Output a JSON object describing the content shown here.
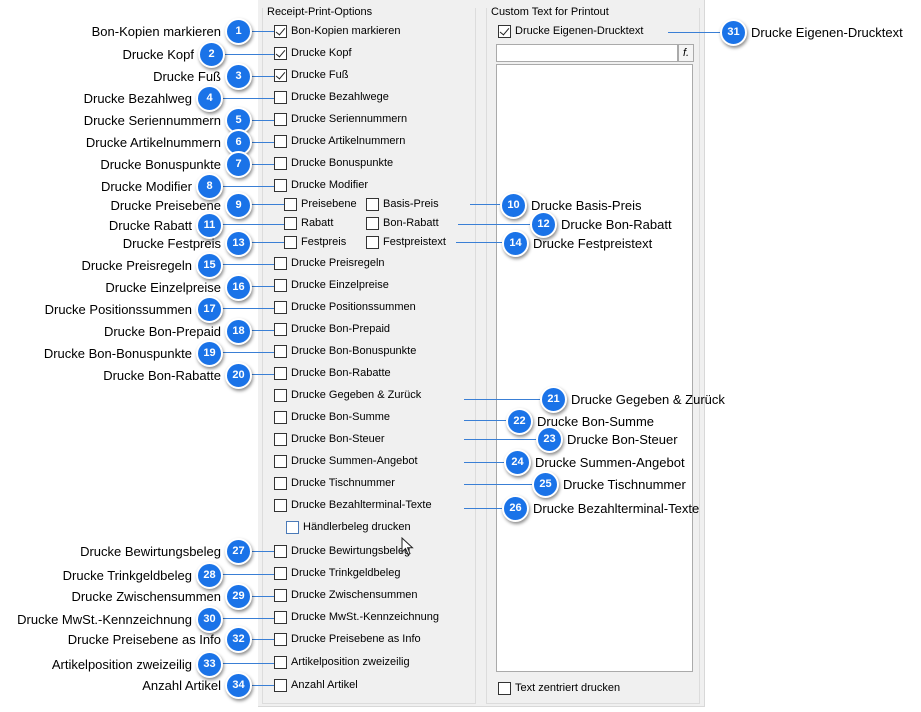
{
  "groups": {
    "receipt_title": "Receipt-Print-Options",
    "custom_title": "Custom Text for Printout"
  },
  "custom": {
    "drucke_eigenen_drucktext": "Drucke Eigenen-Drucktext",
    "fx_label": "f",
    "text_zentriert": "Text zentriert drucken"
  },
  "options": [
    {
      "label": "Bon-Kopien markieren",
      "checked": true
    },
    {
      "label": "Drucke Kopf",
      "checked": true
    },
    {
      "label": "Drucke Fuß",
      "checked": true
    },
    {
      "label": "Drucke Bezahlwege",
      "checked": false
    },
    {
      "label": "Drucke Seriennummern",
      "checked": false
    },
    {
      "label": "Drucke Artikelnummern",
      "checked": false
    },
    {
      "label": "Drucke Bonuspunkte",
      "checked": false
    },
    {
      "label": "Drucke Modifier",
      "checked": false
    },
    {
      "label": "Preisebene",
      "checked": false
    },
    {
      "label": "Basis-Preis",
      "checked": false
    },
    {
      "label": "Rabatt",
      "checked": false
    },
    {
      "label": "Bon-Rabatt",
      "checked": false
    },
    {
      "label": "Festpreis",
      "checked": false
    },
    {
      "label": "Festpreistext",
      "checked": false
    },
    {
      "label": "Drucke Preisregeln",
      "checked": false
    },
    {
      "label": "Drucke Einzelpreise",
      "checked": false
    },
    {
      "label": "Drucke Positionssummen",
      "checked": false
    },
    {
      "label": "Drucke Bon-Prepaid",
      "checked": false
    },
    {
      "label": "Drucke Bon-Bonuspunkte",
      "checked": false
    },
    {
      "label": "Drucke Bon-Rabatte",
      "checked": false
    },
    {
      "label": "Drucke Gegeben & Zurück",
      "checked": false
    },
    {
      "label": "Drucke Bon-Summe",
      "checked": false
    },
    {
      "label": "Drucke Bon-Steuer",
      "checked": false
    },
    {
      "label": "Drucke Summen-Angebot",
      "checked": false
    },
    {
      "label": "Drucke Tischnummer",
      "checked": false
    },
    {
      "label": "Drucke Bezahlterminal-Texte",
      "checked": false
    },
    {
      "label": "Händlerbeleg drucken",
      "checked": false
    },
    {
      "label": "Drucke Bewirtungsbeleg",
      "checked": false
    },
    {
      "label": "Drucke Trinkgeldbeleg",
      "checked": false
    },
    {
      "label": "Drucke Zwischensummen",
      "checked": false
    },
    {
      "label": "Drucke MwSt.-Kennzeichnung",
      "checked": false
    },
    {
      "label": "Drucke Preisebene as Info",
      "checked": false
    },
    {
      "label": "Artikelposition zweizeilig",
      "checked": false
    },
    {
      "label": "Anzahl Artikel",
      "checked": false
    }
  ],
  "callouts": [
    {
      "num": "1",
      "text": "Bon-Kopien markieren"
    },
    {
      "num": "2",
      "text": "Drucke Kopf"
    },
    {
      "num": "3",
      "text": "Drucke Fuß"
    },
    {
      "num": "4",
      "text": "Drucke Bezahlweg"
    },
    {
      "num": "5",
      "text": "Drucke Seriennummern"
    },
    {
      "num": "6",
      "text": "Drucke Artikelnummern"
    },
    {
      "num": "7",
      "text": "Drucke Bonuspunkte"
    },
    {
      "num": "8",
      "text": "Drucke Modifier"
    },
    {
      "num": "9",
      "text": "Drucke Preisebene"
    },
    {
      "num": "10",
      "text": "Drucke Basis-Preis"
    },
    {
      "num": "11",
      "text": "Drucke Rabatt"
    },
    {
      "num": "12",
      "text": "Drucke Bon-Rabatt"
    },
    {
      "num": "13",
      "text": "Drucke Festpreis"
    },
    {
      "num": "14",
      "text": "Drucke Festpreistext"
    },
    {
      "num": "15",
      "text": "Drucke Preisregeln"
    },
    {
      "num": "16",
      "text": "Drucke Einzelpreise"
    },
    {
      "num": "17",
      "text": "Drucke Positionssummen"
    },
    {
      "num": "18",
      "text": "Drucke Bon-Prepaid"
    },
    {
      "num": "19",
      "text": "Drucke Bon-Bonuspunkte"
    },
    {
      "num": "20",
      "text": "Drucke Bon-Rabatte"
    },
    {
      "num": "21",
      "text": "Drucke Gegeben & Zurück"
    },
    {
      "num": "22",
      "text": "Drucke Bon-Summe"
    },
    {
      "num": "23",
      "text": "Drucke Bon-Steuer"
    },
    {
      "num": "24",
      "text": "Drucke Summen-Angebot"
    },
    {
      "num": "25",
      "text": "Drucke Tischnummer"
    },
    {
      "num": "26",
      "text": "Drucke Bezahlterminal-Texte"
    },
    {
      "num": "27",
      "text": "Drucke Bewirtungsbeleg"
    },
    {
      "num": "28",
      "text": "Drucke Trinkgeldbeleg"
    },
    {
      "num": "29",
      "text": "Drucke Zwischensummen"
    },
    {
      "num": "30",
      "text": "Drucke MwSt.-Kennzeichnung"
    },
    {
      "num": "31",
      "text": "Drucke Eigenen-Drucktext"
    },
    {
      "num": "32",
      "text": "Drucke Preisebene as Info"
    },
    {
      "num": "33",
      "text": "Artikelposition zweizeilig"
    },
    {
      "num": "34",
      "text": "Anzahl Artikel"
    }
  ],
  "colors": {
    "badge": "#1a73e8",
    "leader_line": "#3a7fd5"
  }
}
